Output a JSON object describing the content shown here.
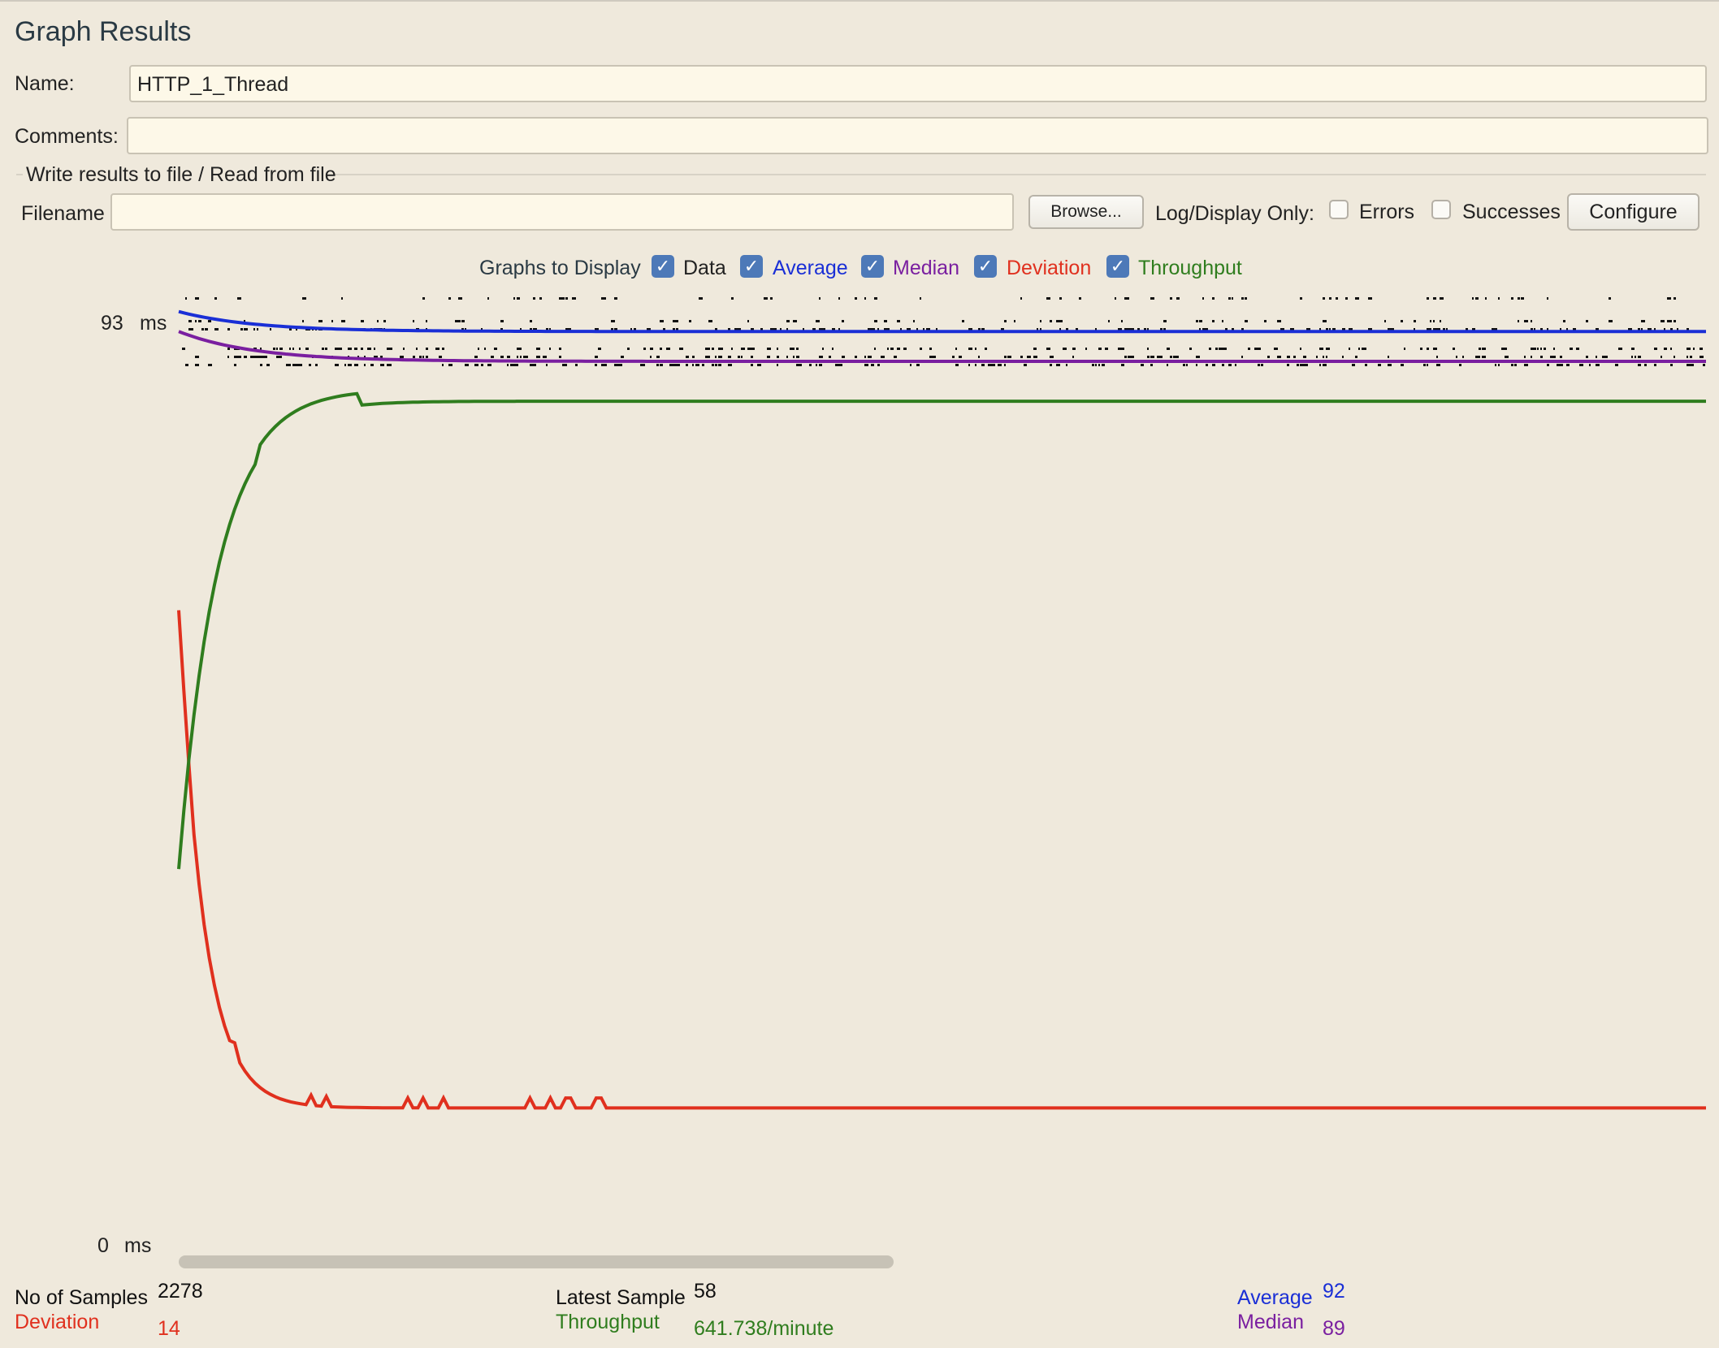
{
  "panel": {
    "title": "Graph Results"
  },
  "form": {
    "name_label": "Name:",
    "name_value": "HTTP_1_Thread",
    "comments_label": "Comments:",
    "comments_value": "",
    "file_section_title": "Write results to file / Read from file",
    "filename_label": "Filename",
    "filename_value": "",
    "browse_label": "Browse...",
    "log_display_label": "Log/Display Only:",
    "errors_label": "Errors",
    "errors_checked": false,
    "successes_label": "Successes",
    "successes_checked": false,
    "configure_label": "Configure"
  },
  "graphs_to_display": {
    "label": "Graphs to Display",
    "options": [
      {
        "label": "Data",
        "checked": true,
        "color": "#111111"
      },
      {
        "label": "Average",
        "checked": true,
        "color": "#1a2fd6"
      },
      {
        "label": "Median",
        "checked": true,
        "color": "#7a1fa0"
      },
      {
        "label": "Deviation",
        "checked": true,
        "color": "#e0301e"
      },
      {
        "label": "Throughput",
        "checked": true,
        "color": "#2f7d1e"
      }
    ]
  },
  "chart_data": {
    "type": "line",
    "y_max_label": "93",
    "y_min_label": "0",
    "y_unit": "ms",
    "ylim": [
      0,
      93
    ],
    "sample_count": 2278,
    "series": [
      {
        "name": "Average",
        "color": "#1a2fd6",
        "start": 94,
        "end": 92
      },
      {
        "name": "Median",
        "color": "#7a1fa0",
        "start": 92,
        "end": 89
      },
      {
        "name": "Deviation",
        "color": "#e0301e",
        "start": 64,
        "end": 14
      },
      {
        "name": "Throughput",
        "color": "#2f7d1e",
        "start": 38,
        "end": 85
      }
    ]
  },
  "stats": {
    "no_of_samples_label": "No of Samples",
    "no_of_samples_value": "2278",
    "deviation_label": "Deviation",
    "deviation_value": "14",
    "latest_sample_label": "Latest Sample",
    "latest_sample_value": "58",
    "throughput_label": "Throughput",
    "throughput_value": "641.738/minute",
    "average_label": "Average",
    "average_value": "92",
    "median_label": "Median",
    "median_value": "89"
  },
  "colors": {
    "background": "#efe9dc",
    "field_background": "#fdf8e8",
    "checkbox_checked": "#4d79b8"
  }
}
